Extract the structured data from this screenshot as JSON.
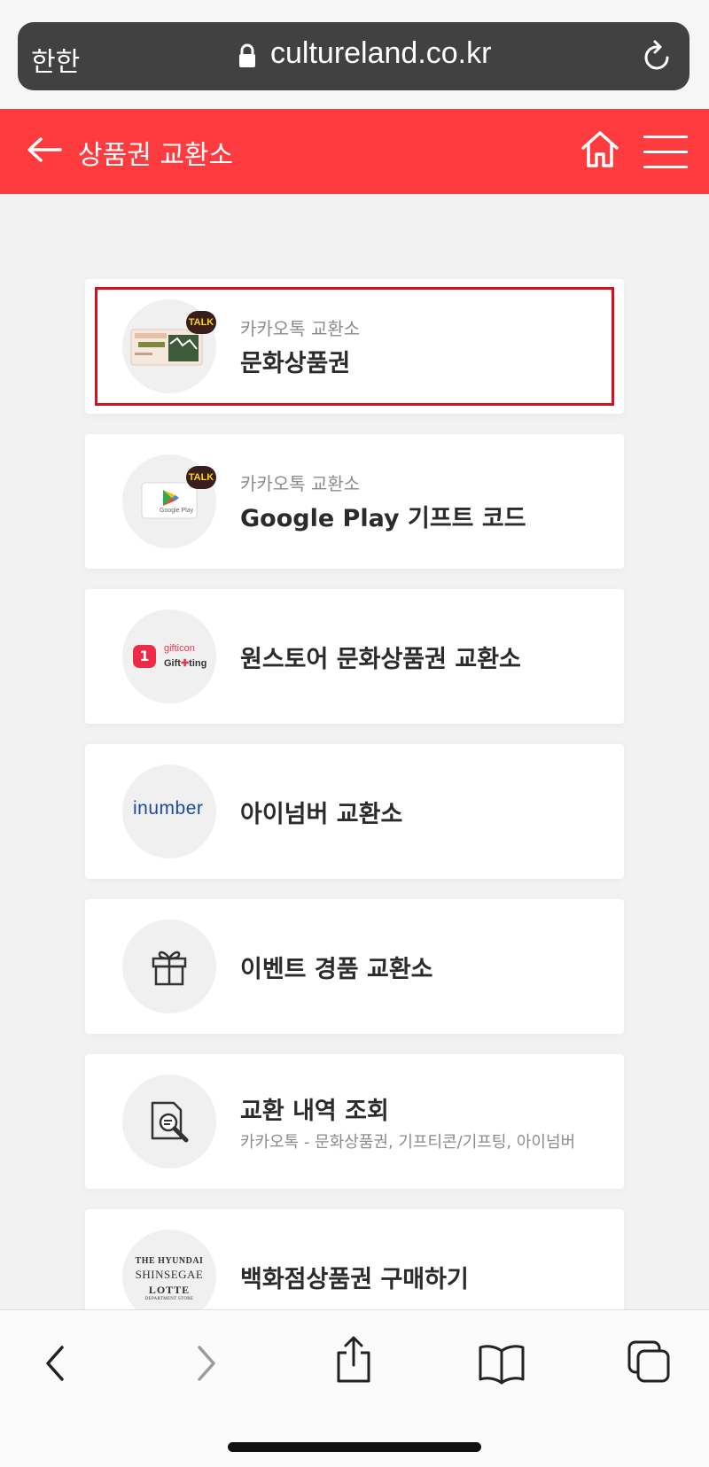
{
  "browser": {
    "aa_label": "한한",
    "url": "cultureland.co.kr"
  },
  "header": {
    "title": "상품권 교환소"
  },
  "cards": [
    {
      "sub": "카카오톡 교환소",
      "main": "문화상품권",
      "desc": "",
      "selected": true
    },
    {
      "sub": "카카오톡 교환소",
      "main": "Google Play 기프트 코드",
      "desc": ""
    },
    {
      "sub": "",
      "main": "원스토어 문화상품권 교환소",
      "desc": ""
    },
    {
      "sub": "",
      "main": "아이넘버 교환소",
      "desc": ""
    },
    {
      "sub": "",
      "main": "이벤트 경품 교환소",
      "desc": ""
    },
    {
      "sub": "",
      "main": "교환 내역 조회",
      "desc": "카카오톡 - 문화상품권, 기프티콘/기프팅, 아이넘버"
    },
    {
      "sub": "",
      "main": "백화점상품권 구매하기",
      "desc": ""
    }
  ],
  "logos": {
    "talk_badge": "TALK",
    "google_play": "Google Play",
    "gifticon": "gifticon",
    "giftting": "Gift",
    "giftting_b": "ting",
    "onestore_num": "1",
    "inumber": "inumber",
    "hyundai": "THE HYUNDAI",
    "shinsegae": "SHINSEGAE",
    "lotte": "LOTTE",
    "lotte_sub": "DEPARTMENT STORE"
  },
  "colors": {
    "header_bg": "#fe3b3e",
    "selected_border": "#d6121f",
    "urlbar_bg": "#414141"
  }
}
